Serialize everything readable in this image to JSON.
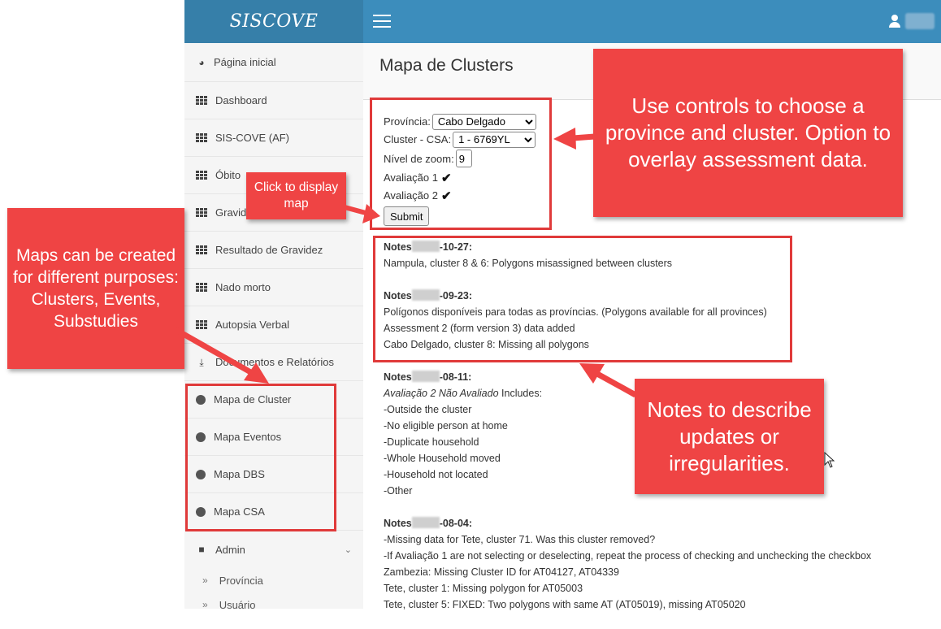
{
  "app": {
    "brand": "SISCOVE"
  },
  "sidebar": {
    "items": [
      {
        "label": "Página inicial",
        "icon": "dashboard-gauge-icon"
      },
      {
        "label": "Dashboard",
        "icon": "grid-icon"
      },
      {
        "label": "SIS-COVE (AF)",
        "icon": "grid-icon"
      },
      {
        "label": "Óbito",
        "icon": "grid-icon"
      },
      {
        "label": "Gravidez",
        "icon": "grid-icon"
      },
      {
        "label": "Resultado de Gravidez",
        "icon": "grid-icon"
      },
      {
        "label": "Nado morto",
        "icon": "grid-icon"
      },
      {
        "label": "Autopsia Verbal",
        "icon": "grid-icon"
      },
      {
        "label": "Documentos e Relatórios",
        "icon": "download-icon"
      },
      {
        "label": "Mapa de Cluster",
        "icon": "globe-icon"
      },
      {
        "label": "Mapa Eventos",
        "icon": "globe-icon"
      },
      {
        "label": "Mapa DBS",
        "icon": "globe-icon"
      },
      {
        "label": "Mapa CSA",
        "icon": "globe-icon"
      }
    ],
    "admin": {
      "label": "Admin",
      "sub": [
        "Província",
        "Usuário"
      ]
    }
  },
  "page": {
    "title": "Mapa de Clusters"
  },
  "form": {
    "provincia_label": "Província:",
    "provincia_value": "Cabo Delgado",
    "cluster_label": "Cluster - CSA:",
    "cluster_value": "1 - 6769YL",
    "zoom_label": "Nível de zoom:",
    "zoom_value": "9",
    "aval1_label": "Avaliação 1",
    "aval2_label": "Avaliação 2",
    "submit_label": "Submit"
  },
  "notes": [
    {
      "head": "-10-27:",
      "lines": [
        "Nampula, cluster 8 & 6: Polygons misassigned between clusters"
      ]
    },
    {
      "head": "-09-23:",
      "lines": [
        "Polígonos disponíveis para todas as províncias. (Polygons available for all provinces)",
        "Assessment 2 (form version 3) data added",
        "Cabo Delgado, cluster 8: Missing all polygons"
      ]
    },
    {
      "head": "-08-11:",
      "italic": "Avaliação 2 Não Avaliado",
      "includes": " Includes:",
      "lines": [
        "-Outside the cluster",
        "-No eligible person at home",
        "-Duplicate household",
        "-Whole Household moved",
        "-Household not located",
        "-Other"
      ]
    },
    {
      "head": "-08-04:",
      "lines": [
        "-Missing data for Tete, cluster 71. Was this cluster removed?",
        "-If Avaliação 1 are not selecting or deselecting, repeat the process of checking and unchecking the checkbox",
        "Zambezia: Missing Cluster ID for AT04127, AT04339",
        "Tete, cluster 1: Missing polygon for AT05003",
        "Tete, cluster 5: FIXED: Two polygons with same AT (AT05019), missing AT05020"
      ]
    }
  ],
  "notes_prefix": "Notes",
  "callouts": {
    "maps": "Maps can be created for different purposes: Clusters, Events, Substudies",
    "click": "Click to display map",
    "controls": "Use controls to choose a province and cluster. Option to overlay assessment data.",
    "notes": "Notes to describe updates or irregularities."
  },
  "colors": {
    "header": "#3c8dbc",
    "brand_bg": "#367fa9",
    "callout": "#ef4444"
  }
}
